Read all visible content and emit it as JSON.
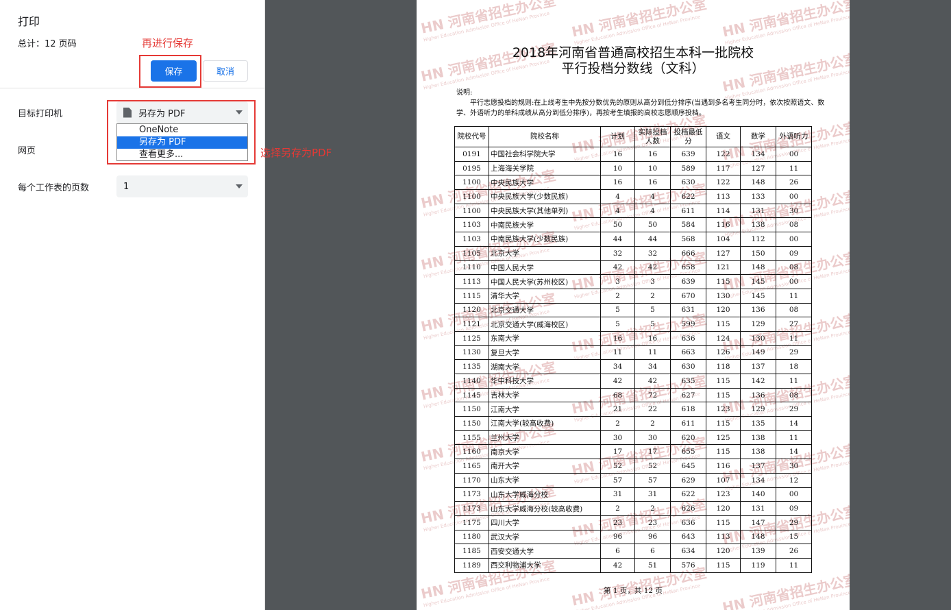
{
  "print_panel": {
    "title": "打印",
    "total": "总计：12 页码",
    "save_label": "保存",
    "cancel_label": "取消",
    "dest_label": "目标打印机",
    "dest_value": "另存为 PDF",
    "dest_options": [
      "OneNote",
      "另存为 PDF",
      "查看更多..."
    ],
    "pages_label": "网页",
    "per_sheet_label": "每个工作表的页数",
    "per_sheet_value": "1"
  },
  "annotations": {
    "save_hint": "再进行保存",
    "pdf_hint": "选择另存为PDF",
    "color": "#e53935"
  },
  "document": {
    "title_line1": "2018年河南省普通高校招生本科一批院校",
    "title_line2": "平行投档分数线（文科）",
    "note_title": "说明:",
    "note_body": "平行志愿投档的规则:在上线考生中先按分数优先的原则从高分到低分排序(当遇到多名考生同分时，依次按照语文、数学、外语听力的单科成绩从高分到低分排序)，再按考生填报的高校志愿顺序投档。",
    "watermark": "河南省招生办公室",
    "watermark_en": "Higher Education Admission Office of HeNan Province",
    "headers": [
      "院校代号",
      "院校名称",
      "计划",
      "实际投档人数",
      "投档最低分",
      "语文",
      "数学",
      "外语听力"
    ],
    "rows": [
      [
        "0191",
        "中国社会科学院大学",
        "16",
        "16",
        "639",
        "122",
        "134",
        "00"
      ],
      [
        "0195",
        "上海海关学院",
        "10",
        "10",
        "589",
        "117",
        "127",
        "11"
      ],
      [
        "1100",
        "中央民族大学",
        "16",
        "16",
        "630",
        "122",
        "148",
        "26"
      ],
      [
        "1100",
        "中央民族大学(少数民族)",
        "4",
        "4",
        "622",
        "113",
        "133",
        "00"
      ],
      [
        "1100",
        "中央民族大学(其他单列)",
        "4",
        "4",
        "611",
        "114",
        "131",
        "30"
      ],
      [
        "1103",
        "中南民族大学",
        "50",
        "50",
        "584",
        "116",
        "138",
        "08"
      ],
      [
        "1103",
        "中南民族大学(少数民族)",
        "44",
        "44",
        "568",
        "104",
        "112",
        "00"
      ],
      [
        "1105",
        "北京大学",
        "32",
        "32",
        "666",
        "127",
        "150",
        "09"
      ],
      [
        "1110",
        "中国人民大学",
        "42",
        "42",
        "658",
        "121",
        "148",
        "08"
      ],
      [
        "1113",
        "中国人民大学(苏州校区)",
        "3",
        "3",
        "639",
        "115",
        "145",
        "00"
      ],
      [
        "1115",
        "清华大学",
        "2",
        "2",
        "670",
        "130",
        "145",
        "11"
      ],
      [
        "1120",
        "北京交通大学",
        "5",
        "5",
        "631",
        "120",
        "136",
        "08"
      ],
      [
        "1121",
        "北京交通大学(威海校区)",
        "5",
        "5",
        "599",
        "115",
        "129",
        "27"
      ],
      [
        "1125",
        "东南大学",
        "16",
        "16",
        "636",
        "124",
        "130",
        "11"
      ],
      [
        "1130",
        "复旦大学",
        "11",
        "11",
        "663",
        "126",
        "149",
        "29"
      ],
      [
        "1135",
        "湖南大学",
        "34",
        "34",
        "630",
        "118",
        "137",
        "18"
      ],
      [
        "1140",
        "华中科技大学",
        "42",
        "42",
        "635",
        "115",
        "142",
        "11"
      ],
      [
        "1145",
        "吉林大学",
        "68",
        "72",
        "627",
        "115",
        "136",
        "08"
      ],
      [
        "1150",
        "江南大学",
        "21",
        "22",
        "618",
        "123",
        "129",
        "29"
      ],
      [
        "1150",
        "江南大学(较高收费)",
        "2",
        "2",
        "611",
        "115",
        "135",
        "14"
      ],
      [
        "1155",
        "兰州大学",
        "30",
        "30",
        "620",
        "125",
        "138",
        "11"
      ],
      [
        "1160",
        "南京大学",
        "17",
        "17",
        "655",
        "115",
        "138",
        "14"
      ],
      [
        "1165",
        "南开大学",
        "52",
        "52",
        "645",
        "116",
        "137",
        "30"
      ],
      [
        "1170",
        "山东大学",
        "57",
        "57",
        "629",
        "107",
        "134",
        "12"
      ],
      [
        "1173",
        "山东大学威海分校",
        "31",
        "31",
        "622",
        "123",
        "140",
        "00"
      ],
      [
        "1173",
        "山东大学威海分校(较高收费)",
        "2",
        "2",
        "626",
        "120",
        "131",
        "09"
      ],
      [
        "1175",
        "四川大学",
        "23",
        "23",
        "636",
        "115",
        "147",
        "29"
      ],
      [
        "1180",
        "武汉大学",
        "96",
        "96",
        "643",
        "113",
        "148",
        "15"
      ],
      [
        "1185",
        "西安交通大学",
        "6",
        "6",
        "634",
        "120",
        "139",
        "26"
      ],
      [
        "1189",
        "西交利物浦大学",
        "42",
        "51",
        "576",
        "115",
        "119",
        "11"
      ]
    ],
    "footer": "第 1 页，共 12 页"
  }
}
